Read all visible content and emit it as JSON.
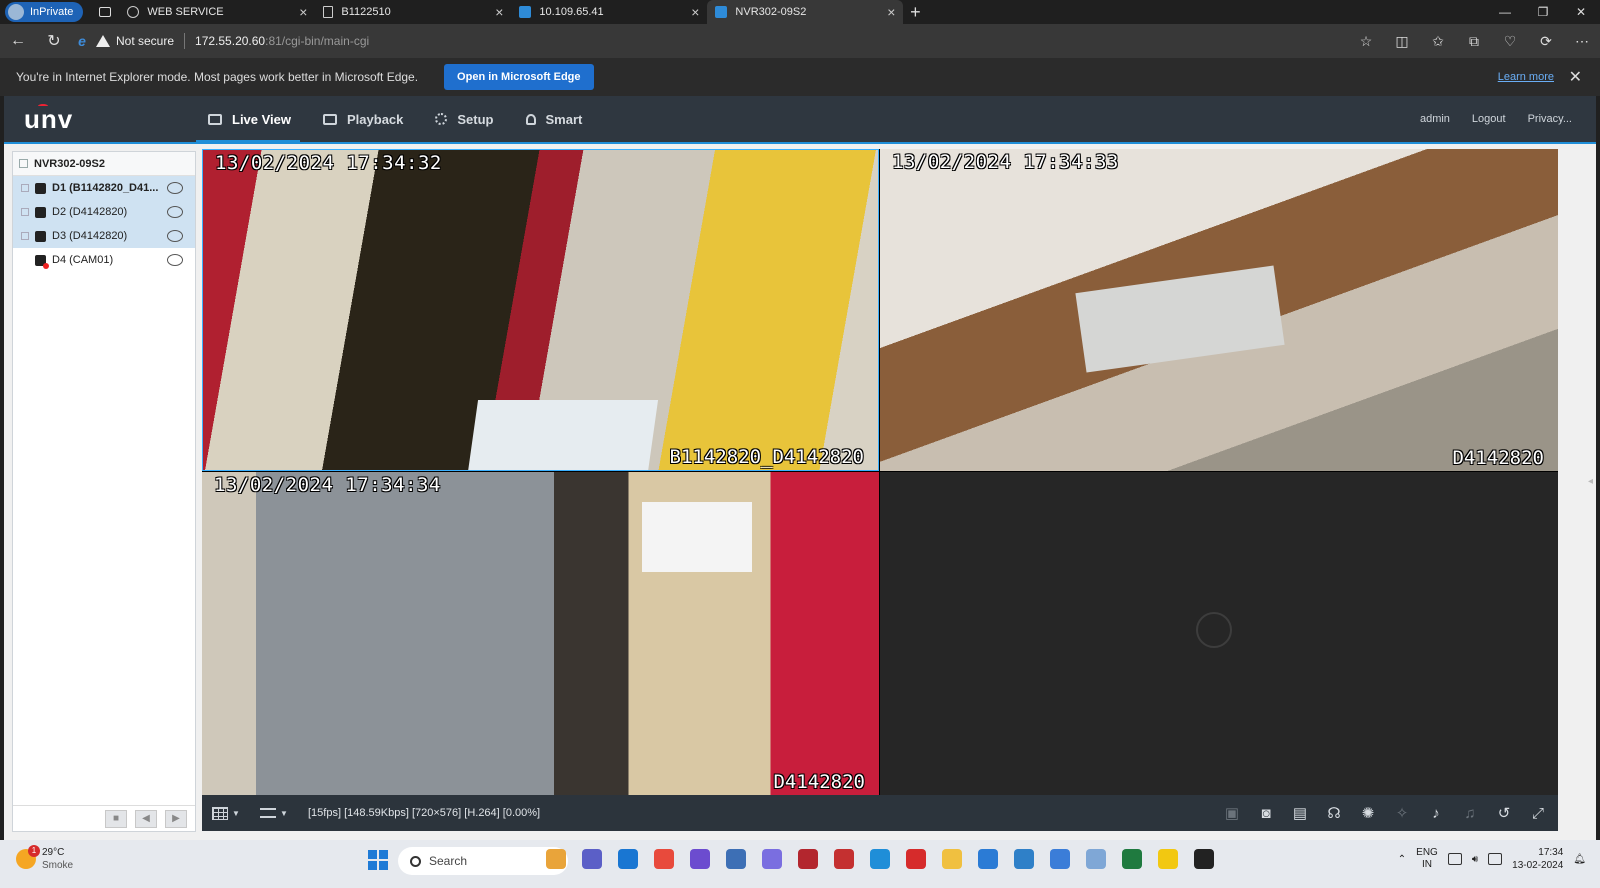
{
  "browser": {
    "inprivate_label": "InPrivate",
    "tabs": [
      {
        "label": "WEB SERVICE",
        "icon": "globe-icon"
      },
      {
        "label": "B1122510",
        "icon": "document-icon"
      },
      {
        "label": "10.109.65.41",
        "icon": "network-icon"
      },
      {
        "label": "NVR302-09S2",
        "icon": "network-icon",
        "active": true
      }
    ],
    "new_tab": "+",
    "not_secure": "Not secure",
    "url_host": "172.55.20.60",
    "url_rest": ":81/cgi-bin/main-cgi"
  },
  "ie_notice": {
    "message": "You're in Internet Explorer mode. Most pages work better in Microsoft Edge.",
    "open_button": "Open in Microsoft Edge",
    "learn_more": "Learn more"
  },
  "app": {
    "logo": "unv",
    "nav": [
      {
        "label": "Live View",
        "icon": "monitor-icon",
        "active": true
      },
      {
        "label": "Playback",
        "icon": "film-icon"
      },
      {
        "label": "Setup",
        "icon": "gear-icon"
      },
      {
        "label": "Smart",
        "icon": "user-icon"
      }
    ],
    "user": "admin",
    "logout": "Logout",
    "privacy": "Privacy..."
  },
  "sidebar": {
    "device": "NVR302-09S2",
    "channels": [
      {
        "label": "D1 (B1142820_D41...",
        "selected": true,
        "bold": true,
        "offline": false
      },
      {
        "label": "D2 (D4142820)",
        "selected": true,
        "bold": false,
        "offline": false
      },
      {
        "label": "D3 (D4142820)",
        "selected": true,
        "bold": false,
        "offline": false
      },
      {
        "label": "D4 (CAM01)",
        "selected": false,
        "bold": false,
        "offline": true
      }
    ]
  },
  "video": {
    "tiles": [
      {
        "timestamp": "13/02/2024 17:34:32",
        "channel_label": "B1142820_D4142820"
      },
      {
        "timestamp": "13/02/2024 17:34:33",
        "channel_label": "D4142820"
      },
      {
        "timestamp": "13/02/2024 17:34:34",
        "channel_label": "D4142820"
      }
    ]
  },
  "player_toolbar": {
    "stream_info": "[15fps] [148.59Kbps] [720×576] [H.264] [0.00%]"
  },
  "taskbar": {
    "temperature": "29°C",
    "condition": "Smoke",
    "weather_badge": "1",
    "search_placeholder": "Search",
    "lang_top": "ENG",
    "lang_bottom": "IN",
    "time": "17:34",
    "date": "13-02-2024"
  },
  "colors": {
    "accent": "#1f8ed8",
    "header_bg": "#2f3740",
    "edge_button": "#1f6fce"
  }
}
